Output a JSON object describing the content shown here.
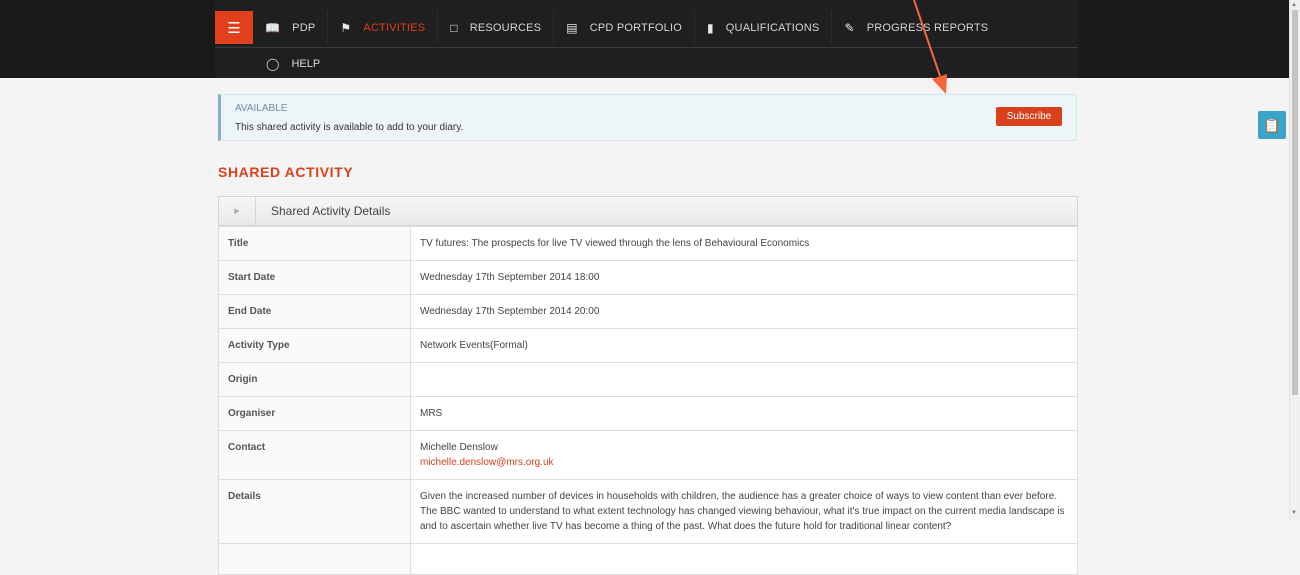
{
  "nav": {
    "menu_icon": "hamburger-icon",
    "items": [
      {
        "label": "PDP",
        "icon": "book-icon"
      },
      {
        "label": "ACTIVITIES",
        "icon": "flag-icon"
      },
      {
        "label": "RESOURCES",
        "icon": "folder-icon"
      },
      {
        "label": "CPD PORTFOLIO",
        "icon": "clipboard-icon"
      },
      {
        "label": "QUALIFICATIONS",
        "icon": "document-icon"
      },
      {
        "label": "PROGRESS REPORTS",
        "icon": "edit-icon"
      }
    ],
    "help": {
      "label": "HELP",
      "icon": "lifebuoy-icon"
    },
    "active": "ACTIVITIES",
    "accent": "#e0401c"
  },
  "alert": {
    "title": "AVAILABLE",
    "message": "This shared activity is available to add to your diary.",
    "subscribe_label": "Subscribe"
  },
  "section_heading": "SHARED ACTIVITY",
  "panel": {
    "title": "Shared Activity Details",
    "rows": [
      {
        "label": "Title",
        "value": "TV futures: The prospects for live TV viewed through the lens of Behavioural Economics"
      },
      {
        "label": "Start Date",
        "value": "Wednesday 17th September 2014 18:00"
      },
      {
        "label": "End Date",
        "value": "Wednesday 17th September 2014 20:00"
      },
      {
        "label": "Activity Type",
        "value": "Network Events(Formal)"
      },
      {
        "label": "Origin",
        "value": ""
      },
      {
        "label": "Organiser",
        "value": "MRS"
      },
      {
        "label": "Contact",
        "value": "Michelle Denslow",
        "email": "michelle.denslow@mrs.org.uk"
      },
      {
        "label": "Details",
        "value": "Given the increased number of devices in households with children, the audience has a greater choice of ways to view content than ever before. The BBC wanted to understand to what extent technology has changed viewing behaviour, what it's true impact on the current media landscape is and to ascertain whether live TV has become a thing of the past. What does the future hold for traditional linear content?"
      }
    ]
  },
  "side_tab_icon": "clipboard-icon"
}
